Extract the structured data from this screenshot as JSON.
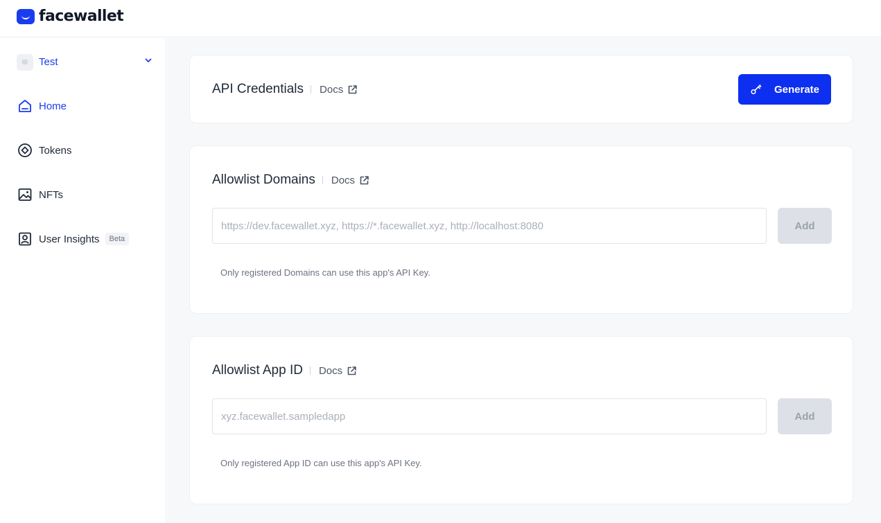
{
  "brand": {
    "name": "facewallet",
    "color": "#1a3cf0"
  },
  "sidebar": {
    "project": {
      "name": "Test"
    },
    "items": [
      {
        "label": "Home",
        "icon": "home-icon",
        "active": true
      },
      {
        "label": "Tokens",
        "icon": "token-icon",
        "active": false
      },
      {
        "label": "NFTs",
        "icon": "image-icon",
        "active": false
      },
      {
        "label": "User Insights",
        "icon": "user-card-icon",
        "active": false,
        "badge": "Beta"
      }
    ]
  },
  "cards": {
    "api_credentials": {
      "title": "API Credentials",
      "docs_label": "Docs",
      "button_label": "Generate"
    },
    "allowlist_domains": {
      "title": "Allowlist Domains",
      "docs_label": "Docs",
      "input_value": "",
      "input_placeholder": "https://dev.facewallet.xyz, https://*.facewallet.xyz, http://localhost:8080",
      "button_label": "Add",
      "hint": "Only registered Domains can use this app's API Key."
    },
    "allowlist_app_id": {
      "title": "Allowlist App ID",
      "docs_label": "Docs",
      "input_value": "",
      "input_placeholder": "xyz.facewallet.sampledapp",
      "button_label": "Add",
      "hint": "Only registered App ID can use this app's API Key."
    }
  },
  "colors": {
    "accent": "#0d2ff0",
    "disabled_button": "#dde1e7",
    "page_background": "#f7f8fa"
  }
}
